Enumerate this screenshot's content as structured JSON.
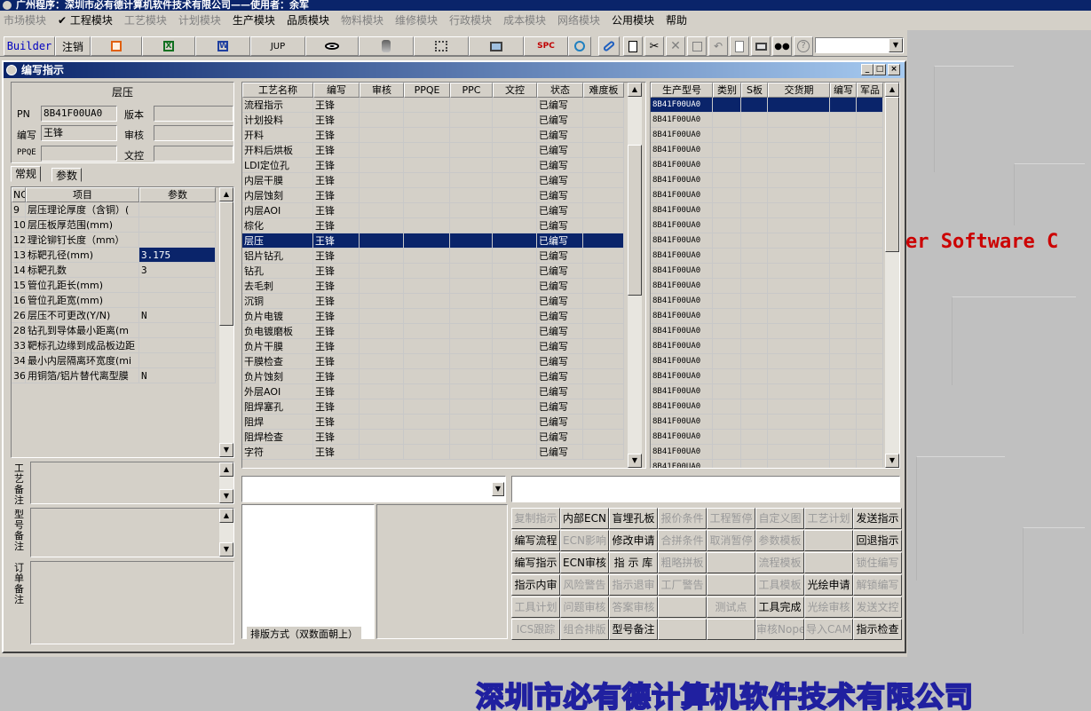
{
  "app": {
    "title": "广州程序：深圳市必有德计算机软件技术有限公司——使用者：余军"
  },
  "menu": [
    {
      "label": "市场模块",
      "enabled": false
    },
    {
      "label": "✔ 工程模块",
      "enabled": true
    },
    {
      "label": "工艺模块",
      "enabled": false
    },
    {
      "label": "计划模块",
      "enabled": false
    },
    {
      "label": "生产模块",
      "enabled": true
    },
    {
      "label": "品质模块",
      "enabled": true
    },
    {
      "label": "物料模块",
      "enabled": false
    },
    {
      "label": "维修模块",
      "enabled": false
    },
    {
      "label": "行政模块",
      "enabled": false
    },
    {
      "label": "成本模块",
      "enabled": false
    },
    {
      "label": "网络模块",
      "enabled": false
    },
    {
      "label": "公用模块",
      "enabled": true
    },
    {
      "label": "帮助",
      "enabled": true
    }
  ],
  "toolbar": {
    "builder": "Builder",
    "logout": "注销",
    "jup": "JUP",
    "spc": "SPC",
    "combo_value": ""
  },
  "window": {
    "title": "编写指示"
  },
  "left": {
    "process_name": "层压",
    "pn_label": "PN",
    "pn_value": "8B41F00UA0",
    "version_label": "版本",
    "version_value": "",
    "author_label": "编写",
    "author_value": "王锋",
    "review_label": "审核",
    "review_value": "",
    "ppqe_label": "PPQE",
    "ppqe_value": "",
    "doc_label": "文控",
    "doc_value": "",
    "tab_general": "常规",
    "tab_params": "参数",
    "param_headers": [
      "NO",
      "项目",
      "参数"
    ],
    "params": [
      {
        "no": "9",
        "item": "层压理论厚度（含铜）(",
        "value": ""
      },
      {
        "no": "10",
        "item": "层压板厚范围(mm)",
        "value": ""
      },
      {
        "no": "12",
        "item": "理论铆钉长度（mm）",
        "value": ""
      },
      {
        "no": "13",
        "item": "标靶孔径(mm)",
        "value": "3.175"
      },
      {
        "no": "14",
        "item": "标靶孔数",
        "value": "3"
      },
      {
        "no": "15",
        "item": "管位孔距长(mm)",
        "value": ""
      },
      {
        "no": "16",
        "item": "管位孔距宽(mm)",
        "value": ""
      },
      {
        "no": "26",
        "item": "层压不可更改(Y/N)",
        "value": "N"
      },
      {
        "no": "28",
        "item": "钻孔到导体最小距离(m",
        "value": ""
      },
      {
        "no": "33",
        "item": "靶标孔边缘到成品板边距",
        "value": ""
      },
      {
        "no": "34",
        "item": "最小内层隔离环宽度(mi",
        "value": ""
      },
      {
        "no": "36",
        "item": "用铜箔/铝片替代离型膜",
        "value": "N"
      }
    ],
    "note_process": "工艺备注",
    "note_model": "型号备注",
    "note_order": "订单备注"
  },
  "middle": {
    "headers": [
      "工艺名称",
      "编写",
      "审核",
      "PPQE",
      "PPC",
      "文控",
      "状态",
      "难度板"
    ],
    "rows": [
      {
        "name": "流程指示",
        "author": "王锋",
        "status": "已编写"
      },
      {
        "name": "计划投料",
        "author": "王锋",
        "status": "已编写"
      },
      {
        "name": "开料",
        "author": "王锋",
        "status": "已编写"
      },
      {
        "name": "开料后烘板",
        "author": "王锋",
        "status": "已编写"
      },
      {
        "name": "LDI定位孔",
        "author": "王锋",
        "status": "已编写"
      },
      {
        "name": "内层干膜",
        "author": "王锋",
        "status": "已编写"
      },
      {
        "name": "内层蚀刻",
        "author": "王锋",
        "status": "已编写"
      },
      {
        "name": "内层AOI",
        "author": "王锋",
        "status": "已编写"
      },
      {
        "name": "棕化",
        "author": "王锋",
        "status": "已编写"
      },
      {
        "name": "层压",
        "author": "王锋",
        "status": "已编写"
      },
      {
        "name": "铝片钻孔",
        "author": "王锋",
        "status": "已编写"
      },
      {
        "name": "钻孔",
        "author": "王锋",
        "status": "已编写"
      },
      {
        "name": "去毛刺",
        "author": "王锋",
        "status": "已编写"
      },
      {
        "name": "沉铜",
        "author": "王锋",
        "status": "已编写"
      },
      {
        "name": "负片电镀",
        "author": "王锋",
        "status": "已编写"
      },
      {
        "name": "负电镀磨板",
        "author": "王锋",
        "status": "已编写"
      },
      {
        "name": "负片干膜",
        "author": "王锋",
        "status": "已编写"
      },
      {
        "name": "干膜检查",
        "author": "王锋",
        "status": "已编写"
      },
      {
        "name": "负片蚀刻",
        "author": "王锋",
        "status": "已编写"
      },
      {
        "name": "外层AOI",
        "author": "王锋",
        "status": "已编写"
      },
      {
        "name": "阻焊塞孔",
        "author": "王锋",
        "status": "已编写"
      },
      {
        "name": "阻焊",
        "author": "王锋",
        "status": "已编写"
      },
      {
        "name": "阻焊检查",
        "author": "王锋",
        "status": "已编写"
      },
      {
        "name": "字符",
        "author": "王锋",
        "status": "已编写"
      }
    ],
    "layout_label": "排版方式（双数面朝上）"
  },
  "right": {
    "headers": [
      "生产型号",
      "类别",
      "S板",
      "交货期",
      "编写",
      "军品"
    ],
    "rows": [
      "8B41F00UA0",
      "8B41F00UA0",
      "8B41F00UA0",
      "8B41F00UA0",
      "8B41F00UA0",
      "8B41F00UA0",
      "8B41F00UA0",
      "8B41F00UA0",
      "8B41F00UA0",
      "8B41F00UA0",
      "8B41F00UA0",
      "8B41F00UA0",
      "8B41F00UA0",
      "8B41F00UA0",
      "8B41F00UA0",
      "8B41F00UA0",
      "8B41F00UA0",
      "8B41F00UA0",
      "8B41F00UA0",
      "8B41F00UA0",
      "8B41F00UA0",
      "8B41F00UA0",
      "8B41F00UA0",
      "8B41F00UA0",
      "8B41F00UA0"
    ]
  },
  "buttons": [
    [
      "复制指示",
      "内部ECN",
      "盲埋孔板",
      "报价条件",
      "工程暂停",
      "自定义图",
      "工艺计划",
      "发送指示"
    ],
    [
      "编写流程",
      "ECN影响",
      "修改申请",
      "合拼条件",
      "取消暂停",
      "参数模板",
      "",
      "回退指示"
    ],
    [
      "编写指示",
      "ECN审核",
      "指 示 库",
      "粗略拼板",
      "",
      "流程模板",
      "",
      "锁住编写"
    ],
    [
      "指示内审",
      "风险警告",
      "指示退审",
      "工厂警告",
      "",
      "工具模板",
      "光绘申请",
      "解锁编写"
    ],
    [
      "工具计划",
      "问题审核",
      "答案审核",
      "",
      "测试点",
      "工具完成",
      "光绘审核",
      "发送文控"
    ],
    [
      "ICS跟踪",
      "组合排版",
      "型号备注",
      "",
      "",
      "审核Nope",
      "导入CAM",
      "指示检查"
    ]
  ],
  "buttons_enabled": [
    [
      false,
      true,
      true,
      false,
      false,
      false,
      false,
      true
    ],
    [
      true,
      false,
      true,
      false,
      false,
      false,
      false,
      true
    ],
    [
      true,
      true,
      true,
      false,
      false,
      false,
      false,
      false
    ],
    [
      true,
      false,
      false,
      false,
      false,
      false,
      true,
      false
    ],
    [
      false,
      false,
      false,
      false,
      false,
      true,
      false,
      false
    ],
    [
      false,
      false,
      true,
      false,
      false,
      false,
      false,
      true
    ]
  ],
  "background": {
    "tagline": "er Software C",
    "company": "深圳市必有德计算机软件技术有限公司"
  }
}
